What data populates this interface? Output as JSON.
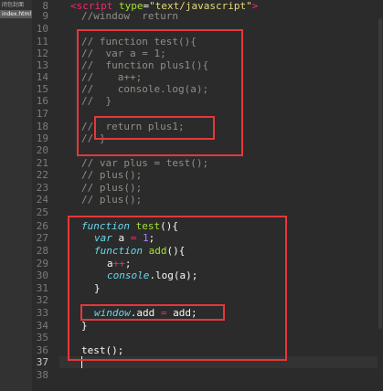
{
  "sidebar": {
    "items": [
      {
        "label": "闭包封面"
      },
      {
        "label": "index.html"
      }
    ]
  },
  "gutter": {
    "line_numbers": [
      "8",
      "9",
      "10",
      "11",
      "12",
      "13",
      "14",
      "15",
      "16",
      "17",
      "18",
      "19",
      "20",
      "21",
      "22",
      "23",
      "24",
      "25",
      "26",
      "27",
      "28",
      "29",
      "30",
      "31",
      "32",
      "33",
      "34",
      "35",
      "36",
      "37",
      "38"
    ],
    "active_line": "37"
  },
  "code": {
    "l8": {
      "lt": "<",
      "tag": "script",
      "attr": "type",
      "eq": "=",
      "val": "\"text/javascript\"",
      "gt": ">"
    },
    "l9": "//window  return",
    "l10": "",
    "l11": "// function test(){",
    "l12": "//  var a = 1;",
    "l13": "//  function plus1(){",
    "l14": "//    a++;",
    "l15": "//    console.log(a);",
    "l16": "//  }",
    "l17": "",
    "l18_a": "//",
    "l18_b": "return plus1;",
    "l19": "// }",
    "l20": "",
    "l21": "// var plus = test();",
    "l22": "// plus();",
    "l23": "// plus();",
    "l24": "// plus();",
    "l25": "",
    "l26": {
      "kw": "function",
      "name": "test",
      "rest": "(){"
    },
    "l27": {
      "kw": "var",
      "name": "a",
      "op": "=",
      "num": "1",
      "end": ";"
    },
    "l28": {
      "kw": "function",
      "name": "add",
      "rest": "(){"
    },
    "l29": {
      "name": "a",
      "op": "++",
      "end": ";"
    },
    "l30": {
      "kw": "console",
      "rest": ".log(a);"
    },
    "l31": "}",
    "l32": "",
    "l33": {
      "kw": "window",
      "name": ".add",
      "op": "=",
      "rest": "add;"
    },
    "l34": "}",
    "l35": "",
    "l36": "test();",
    "l37": "",
    "l38": ""
  },
  "colors": {
    "highlight_box": "#e5373b",
    "comment": "#8e8f86",
    "keyword": "#66d9ef",
    "operator": "#f92672",
    "number": "#ae81ff",
    "string": "#e6db74"
  }
}
